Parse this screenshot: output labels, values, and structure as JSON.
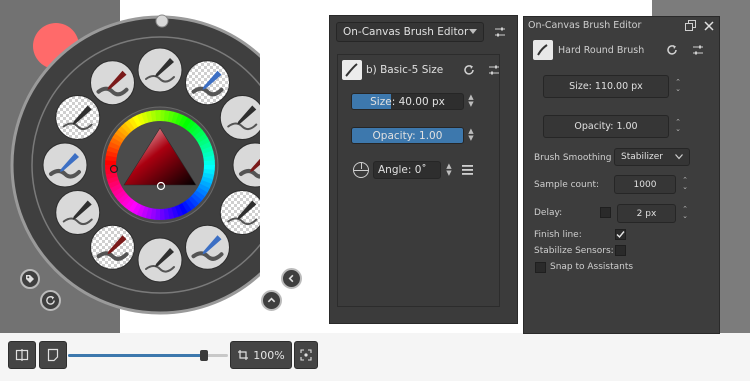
{
  "zoom": {
    "value": "100%",
    "slider_fraction": 0.85
  },
  "popup_palette": {
    "brushes": [
      "ink-pen",
      "eraser-small",
      "marker",
      "eraser-soft",
      "fill-blob",
      "airbrush",
      "pencil-sketch",
      "pencil-soft",
      "basic-ink",
      "basic-pencil",
      "chalk",
      "pencil-light"
    ]
  },
  "brush_editor_a": {
    "dropdown_value": "On-Canvas Brush Editor",
    "preset_name": "b) Basic-5 Size",
    "size": "Size: 40.00 px",
    "size_fraction": 0.35,
    "opacity": "Opacity: 1.00",
    "opacity_fraction": 1.0,
    "angle": "Angle: 0˚"
  },
  "brush_editor_b": {
    "title": "On-Canvas Brush Editor",
    "preset_name": "Hard Round Brush",
    "size": "Size: 110.00 px",
    "opacity": "Opacity: 1.00",
    "smoothing_label": "Brush Smoothing :",
    "smoothing_value": "Stabilizer",
    "sample_count_label": "Sample count:",
    "sample_count_value": "1000",
    "delay_label": "Delay:",
    "delay_value": "2 px",
    "finish_line_label": "Finish line:",
    "finish_line_checked": true,
    "stabilize_sensors_label": "Stabilize Sensors:",
    "stabilize_sensors_checked": false,
    "snap_label": "Snap to Assistants",
    "snap_checked": false
  },
  "colors": {
    "accent": "#3d78ad",
    "current_color": "#ff6a6a",
    "wheel_bg": "#3f3f3f"
  }
}
